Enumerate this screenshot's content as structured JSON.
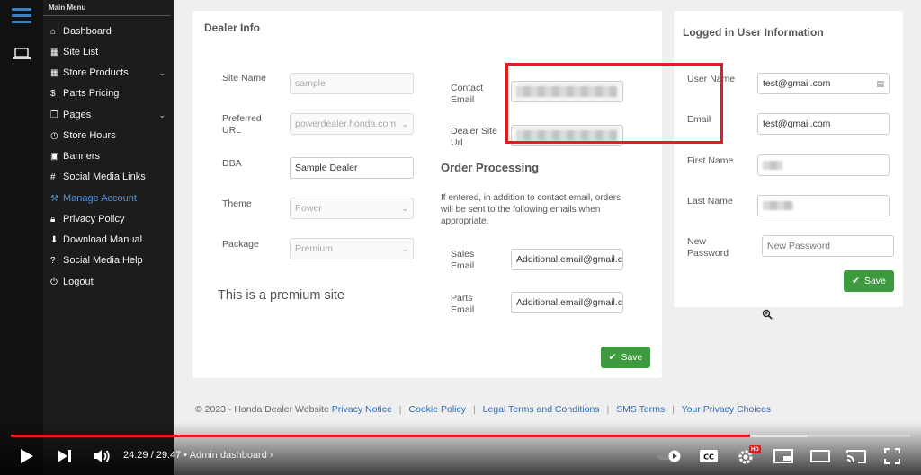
{
  "sidebar": {
    "heading": "Main Menu",
    "items": [
      {
        "label": "Dashboard",
        "icon": "home-icon"
      },
      {
        "label": "Site List",
        "icon": "list-icon"
      },
      {
        "label": "Store Products",
        "icon": "table-icon",
        "has_children": true
      },
      {
        "label": "Parts Pricing",
        "icon": "dollar-icon"
      },
      {
        "label": "Pages",
        "icon": "pages-icon",
        "has_children": true
      },
      {
        "label": "Store Hours",
        "icon": "clock-icon"
      },
      {
        "label": "Banners",
        "icon": "image-icon"
      },
      {
        "label": "Social Media Links",
        "icon": "hash-icon"
      },
      {
        "label": "Manage Account",
        "icon": "wrench-icon",
        "active": true
      },
      {
        "label": "Privacy Policy",
        "icon": "lock-icon"
      },
      {
        "label": "Download Manual",
        "icon": "download-icon"
      },
      {
        "label": "Social Media Help",
        "icon": "question-icon"
      },
      {
        "label": "Logout",
        "icon": "logout-icon"
      }
    ]
  },
  "dealer_info": {
    "title": "Dealer Info",
    "site_name_label": "Site Name",
    "site_name_placeholder": "sample",
    "preferred_url_label": "Preferred URL",
    "preferred_url_value": "powerdealer.honda.com",
    "dba_label": "DBA",
    "dba_value": "Sample Dealer",
    "theme_label": "Theme",
    "theme_value": "Power",
    "package_label": "Package",
    "package_value": "Premium",
    "premium_note": "This is a premium site",
    "contact_email_label": "Contact Email",
    "dealer_site_url_label": "Dealer Site Url",
    "order_processing_title": "Order Processing",
    "order_processing_help": "If entered, in addition to contact email, orders will be sent to the following emails when appropriate.",
    "sales_email_label": "Sales Email",
    "sales_email_value": "Additional.email@gmail.com",
    "parts_email_label": "Parts Email",
    "parts_email_value": "Additional.email@gmail.com",
    "save_label": "Save"
  },
  "user_info": {
    "title": "Logged in User Information",
    "username_label": "User Name",
    "username_value": "test@gmail.com",
    "email_label": "Email",
    "email_value": "test@gmail.com",
    "first_name_label": "First Name",
    "last_name_label": "Last Name",
    "new_password_label": "New Password",
    "new_password_placeholder": "New Password",
    "save_label": "Save"
  },
  "footer": {
    "copyright": "© 2023 - Honda Dealer Website",
    "links": [
      "Privacy Notice",
      "Cookie Policy",
      "Legal Terms and Conditions",
      "SMS Terms",
      "Your Privacy Choices"
    ]
  },
  "player": {
    "time": "24:29 / 29:47",
    "chapter": "Admin dashboard",
    "played_fraction": 0.822,
    "loaded_fraction": 0.885,
    "accent": "#e21b1b",
    "hd_badge": "HD"
  },
  "colors": {
    "accent_blue": "#2d6cb8",
    "save_green": "#3e9a3e",
    "highlight_red": "#e02020"
  }
}
